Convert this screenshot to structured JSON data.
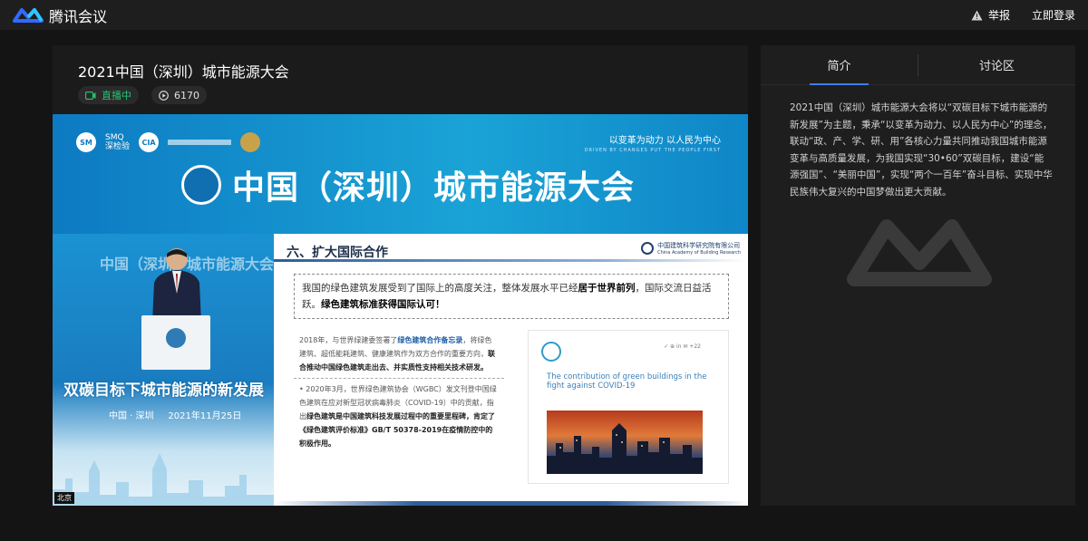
{
  "app": {
    "name": "腾讯会议",
    "report_label": "举报",
    "login_label": "立即登录"
  },
  "live": {
    "title": "2021中国（深圳）城市能源大会",
    "status_label": "直播中",
    "view_count": "6170"
  },
  "video": {
    "banner": {
      "logo_text": "SMQ\n深检验",
      "slogan": "以变革为动力  以人民为中心",
      "slogan_en": "DRIVEN BY CHANGES PUT THE PEOPLE FIRST",
      "title": "中国（深圳）城市能源大会"
    },
    "speaker_panel": {
      "background_title": "中国（深圳）城市能源大会",
      "slogan": "双碳目标下城市能源的新发展",
      "date_line": "中国 · 深圳     2021年11月25日",
      "location_tag": "北京"
    },
    "slide": {
      "title": "六、扩大国际合作",
      "org_name": "中国建筑科学研究院有限公司",
      "org_name_en": "China Academy of Building Research",
      "intro_plain_1": "我国的绿色建筑发展受到了国际上的高度关注，整体发展水平已经",
      "intro_bold_1": "居于世界前列",
      "intro_plain_2": "，国际交流日益活跃。",
      "intro_bold_2": "绿色建筑标准获得国际认可！",
      "point1_plain_1": "2018年，与世界绿建委签署了",
      "point1_hl": "绿色建筑合作备忘录",
      "point1_plain_2": "，将绿色建筑、超低能耗建筑、健康建筑作为双方合作的重要方向，",
      "point1_bold": "联合推动中国绿色建筑走出去、并实质性支持相关技术研发。",
      "point2_plain": "• 2020年3月，世界绿色建筑协会（WGBC）发文刊登中国绿色建筑在应对新型冠状病毒肺炎（COVID-19）中的贡献，指出",
      "point2_bold": "绿色建筑是中国建筑科技发展过程中的重要里程碑，肯定了《绿色建筑评价标准》GB/T 50378-2019在疫情防控中的积极作用。",
      "figure_share": "✓  ⊕  in  ✉  +22",
      "figure_caption": "The contribution of green buildings in the fight against COVID-19"
    }
  },
  "sidebar": {
    "tabs": [
      {
        "label": "简介",
        "active": true
      },
      {
        "label": "讨论区",
        "active": false
      }
    ],
    "intro": "2021中国（深圳）城市能源大会将以“双碳目标下城市能源的新发展”为主题，秉承“以变革为动力、以人民为中心”的理念，联动“政、产、学、研、用”各核心力量共同推动我国城市能源变革与高质量发展，为我国实现“30•60”双碳目标，建设“能源强国”、“美丽中国”，实现“两个一百年”奋斗目标、实现中华民族伟大复兴的中国梦做出更大贡献。"
  },
  "colors": {
    "live_green": "#24c46f",
    "tab_accent": "#3d7cff",
    "brand_blue": "#2f6bff"
  }
}
